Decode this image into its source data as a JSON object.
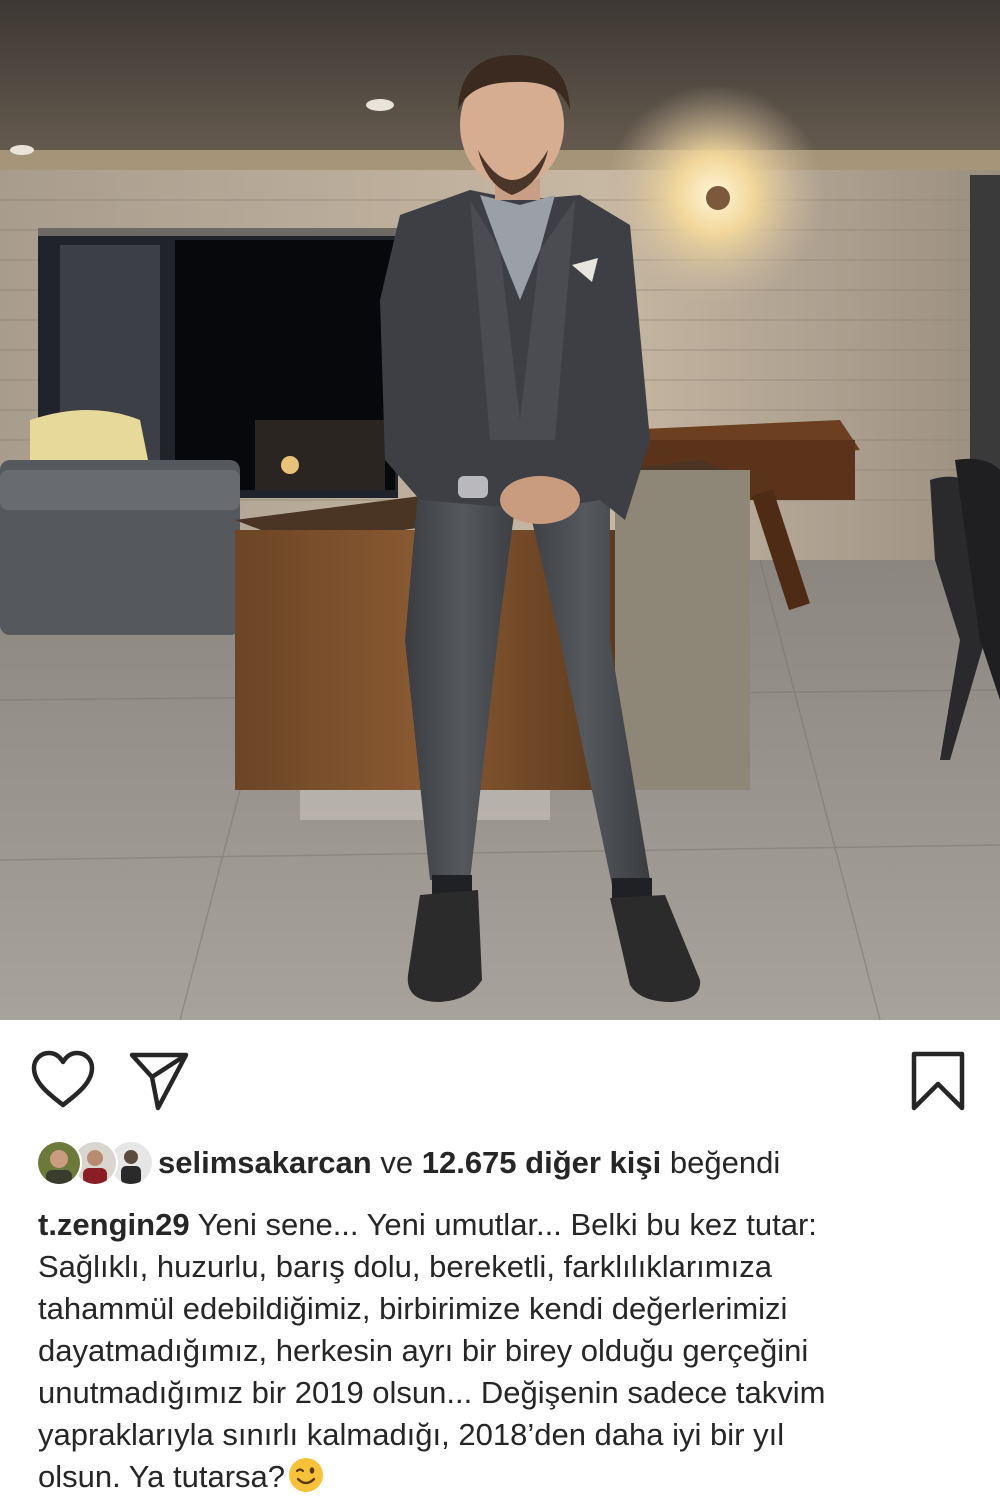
{
  "post": {
    "photo_alt": "Photo",
    "actions": {
      "like_icon": "heart-outline-icon",
      "share_icon": "paper-plane-icon",
      "save_icon": "bookmark-outline-icon"
    },
    "likes": {
      "first_user": "selimsakarcan",
      "connector": "ve",
      "others": "12.675 diğer kişi",
      "suffix": "beğendi"
    },
    "caption": {
      "username": "t.zengin29",
      "lines": [
        "Yeni sene... Yeni umutlar... Belki bu kez tutar:",
        "Sağlıklı, huzurlu, barış dolu, bereketli, farklılıklarımıza",
        "tahammül edebildiğimiz, birbirimize kendi değerlerimizi",
        "dayatmadığımız, herkesin ayrı bir birey olduğu gerçeğini",
        "unutmadığımız bir 2019 olsun... Değişenin sadece takvim",
        "yapraklarıyla sınırlı kalmadığı, 2018’den daha iyi bir yıl",
        "olsun. Ya tutarsa?"
      ],
      "emoji": "winking-face-emoji"
    }
  },
  "colors": {
    "text": "#262626",
    "icon": "#262626",
    "background": "#ffffff"
  }
}
